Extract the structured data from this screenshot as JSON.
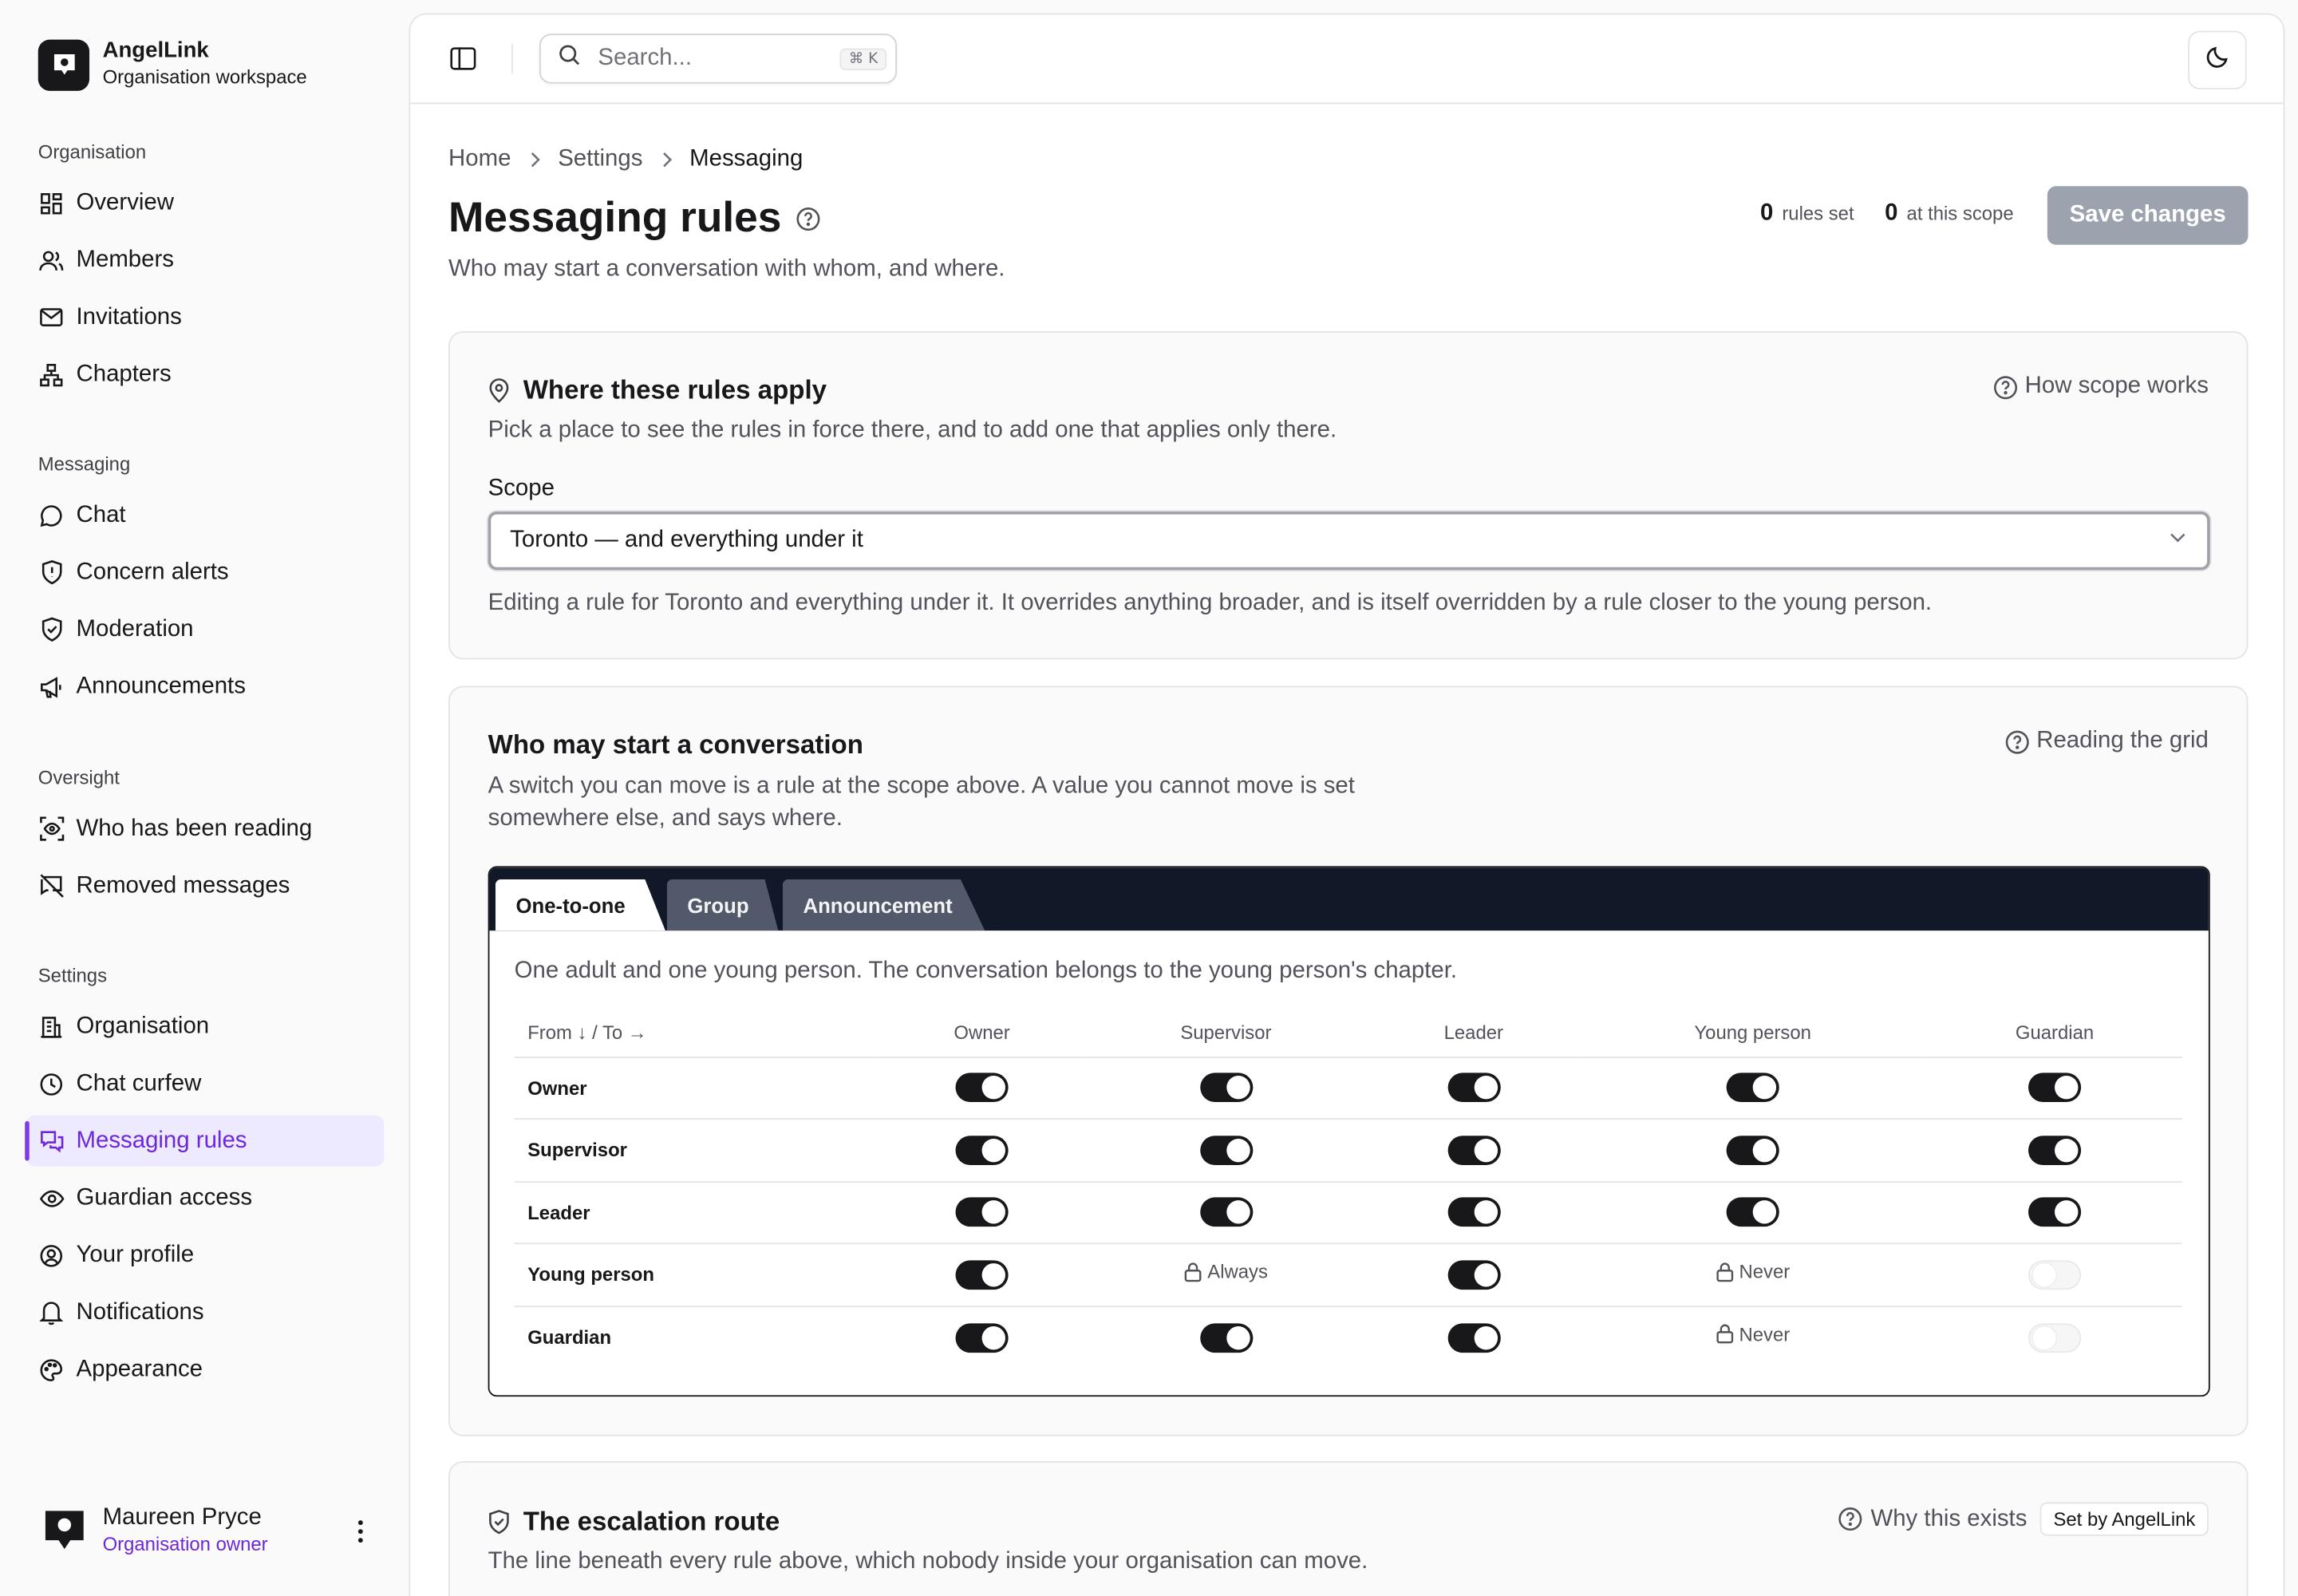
{
  "brand": {
    "name": "AngelLink",
    "subtitle": "Organisation workspace"
  },
  "sidebar": {
    "sections": [
      {
        "heading": "Organisation",
        "items": [
          {
            "label": "Overview",
            "icon": "grid-icon"
          },
          {
            "label": "Members",
            "icon": "users-icon"
          },
          {
            "label": "Invitations",
            "icon": "mail-icon"
          },
          {
            "label": "Chapters",
            "icon": "network-icon"
          }
        ]
      },
      {
        "heading": "Messaging",
        "items": [
          {
            "label": "Chat",
            "icon": "chat-bubble-icon"
          },
          {
            "label": "Concern alerts",
            "icon": "shield-alert-icon"
          },
          {
            "label": "Moderation",
            "icon": "shield-check-icon"
          },
          {
            "label": "Announcements",
            "icon": "megaphone-icon"
          }
        ]
      },
      {
        "heading": "Oversight",
        "items": [
          {
            "label": "Who has been reading",
            "icon": "scan-eye-icon"
          },
          {
            "label": "Removed messages",
            "icon": "message-off-icon"
          }
        ]
      },
      {
        "heading": "Settings",
        "items": [
          {
            "label": "Organisation",
            "icon": "building-icon"
          },
          {
            "label": "Chat curfew",
            "icon": "clock-icon"
          },
          {
            "label": "Messaging rules",
            "icon": "messages-icon",
            "active": true
          },
          {
            "label": "Guardian access",
            "icon": "eye-icon"
          },
          {
            "label": "Your profile",
            "icon": "user-circle-icon"
          },
          {
            "label": "Notifications",
            "icon": "bell-icon"
          },
          {
            "label": "Appearance",
            "icon": "palette-icon"
          }
        ]
      }
    ]
  },
  "user": {
    "name": "Maureen Pryce",
    "role": "Organisation owner"
  },
  "topbar": {
    "search_placeholder": "Search...",
    "shortcut": "⌘ K"
  },
  "breadcrumb": {
    "home": "Home",
    "settings": "Settings",
    "current": "Messaging"
  },
  "page": {
    "title": "Messaging rules",
    "subtitle": "Who may start a conversation with whom, and where.",
    "rules_set_count": "0",
    "rules_set_label": "rules set",
    "scope_count": "0",
    "scope_label": "at this scope",
    "save_label": "Save changes"
  },
  "scope_card": {
    "title": "Where these rules apply",
    "help": "How scope works",
    "description": "Pick a place to see the rules in force there, and to add one that applies only there.",
    "field_label": "Scope",
    "selected": "Toronto — and everything under it",
    "note": "Editing a rule for Toronto and everything under it. It overrides anything broader, and is itself overridden by a rule closer to the young person."
  },
  "grid_card": {
    "title": "Who may start a conversation",
    "help": "Reading the grid",
    "description": "A switch you can move is a rule at the scope above. A value you cannot move is set somewhere else, and says where.",
    "tabs": [
      "One-to-one",
      "Group",
      "Announcement"
    ],
    "active_tab": "One-to-one",
    "tab_description": "One adult and one young person. The conversation belongs to the young person's chapter.",
    "corner_header": "From ↓ / To →",
    "columns": [
      "Owner",
      "Supervisor",
      "Leader",
      "Young person",
      "Guardian"
    ],
    "rows": [
      {
        "label": "Owner",
        "cells": [
          {
            "state": "on"
          },
          {
            "state": "on"
          },
          {
            "state": "on"
          },
          {
            "state": "on"
          },
          {
            "state": "on"
          }
        ]
      },
      {
        "label": "Supervisor",
        "cells": [
          {
            "state": "on"
          },
          {
            "state": "on"
          },
          {
            "state": "on"
          },
          {
            "state": "on"
          },
          {
            "state": "on"
          }
        ]
      },
      {
        "label": "Leader",
        "cells": [
          {
            "state": "on"
          },
          {
            "state": "on"
          },
          {
            "state": "on"
          },
          {
            "state": "on"
          },
          {
            "state": "on"
          }
        ]
      },
      {
        "label": "Young person",
        "cells": [
          {
            "state": "on"
          },
          {
            "state": "locked",
            "text": "Always"
          },
          {
            "state": "on"
          },
          {
            "state": "locked",
            "text": "Never"
          },
          {
            "state": "off"
          }
        ]
      },
      {
        "label": "Guardian",
        "cells": [
          {
            "state": "on"
          },
          {
            "state": "on"
          },
          {
            "state": "on"
          },
          {
            "state": "locked",
            "text": "Never"
          },
          {
            "state": "off"
          }
        ]
      }
    ]
  },
  "escalation_card": {
    "title": "The escalation route",
    "help": "Why this exists",
    "badge": "Set by AngelLink",
    "description": "The line beneath every rule above, which nobody inside your organisation can move."
  },
  "colors": {
    "accent": "#6d28d9",
    "accent_bg": "#ede9fe",
    "dark": "#18181b",
    "save_disabled": "#9ca3af",
    "tab_bar": "#111827"
  }
}
